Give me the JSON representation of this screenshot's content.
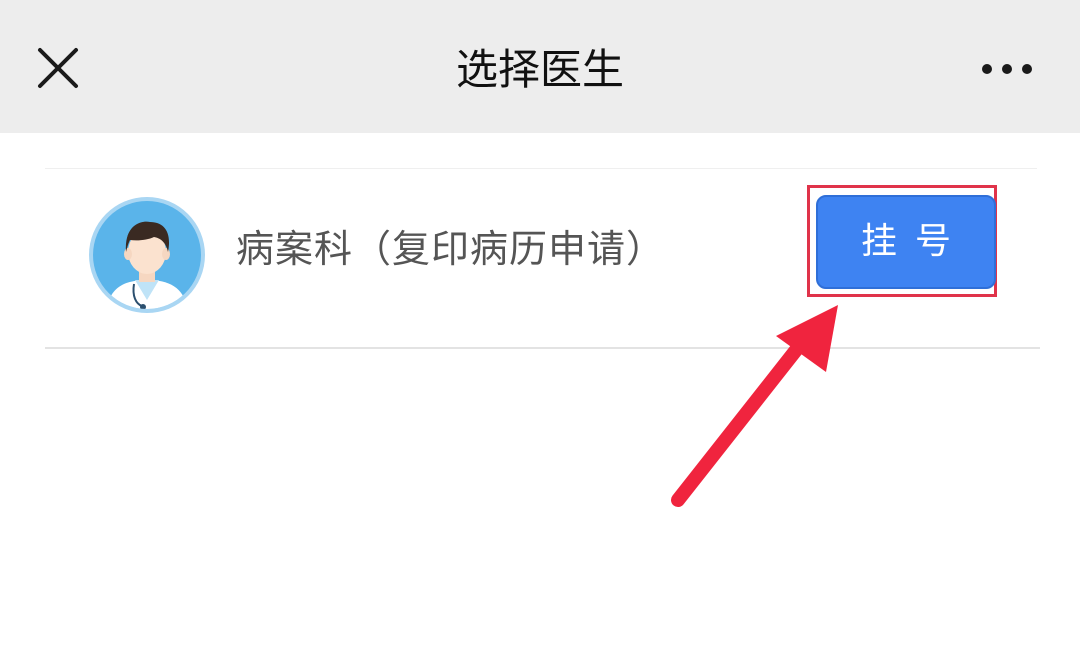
{
  "header": {
    "title": "选择医生",
    "close_icon": "close-icon",
    "more_icon": "more-icon"
  },
  "doctor_list": {
    "items": [
      {
        "avatar_icon": "doctor-avatar",
        "department": "病案科（复印病历申请）",
        "register_label": "挂号"
      }
    ]
  },
  "annotation": {
    "highlight_color": "#e0334a",
    "arrow_color": "#f0243e"
  },
  "colors": {
    "header_bg": "#ededed",
    "button_blue": "#3e83f2",
    "avatar_ring": "#9fd0f0"
  }
}
